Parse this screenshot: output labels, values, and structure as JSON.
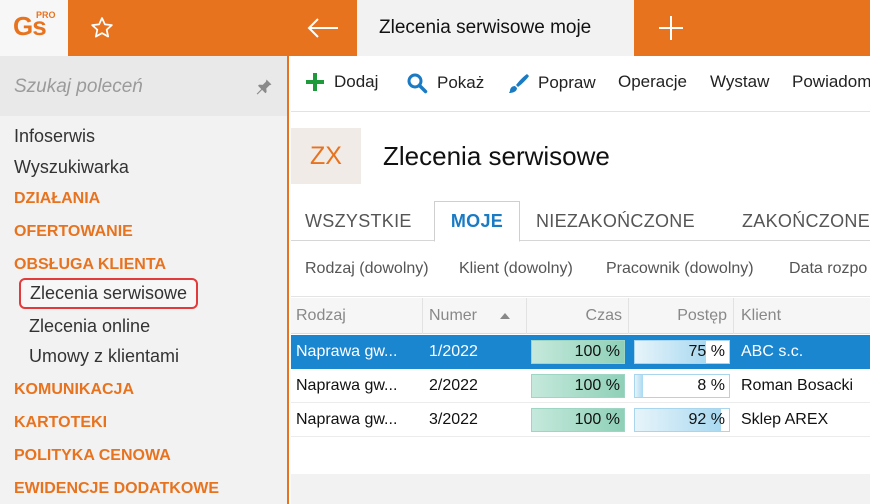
{
  "app": {
    "logo_text": "Gs",
    "logo_badge": "PRO",
    "active_tab_title": "Zlecenia serwisowe moje"
  },
  "colors": {
    "accent": "#e8731f",
    "selection": "#1a86d0",
    "tab_active_text": "#1a7bc4",
    "highlight_border": "#e33b3b"
  },
  "icons": {
    "favorite": "star-icon",
    "back": "arrow-left-icon",
    "new_tab": "plus-icon",
    "pin": "pin-icon",
    "add": "plus-icon",
    "show": "search-icon",
    "edit": "brush-icon"
  },
  "sidebar": {
    "search_placeholder": "Szukaj poleceń",
    "items": [
      {
        "label": "Infoserwis",
        "kind": "item"
      },
      {
        "label": "Wyszukiwarka",
        "kind": "item"
      },
      {
        "label": "DZIAŁANIA",
        "kind": "section"
      },
      {
        "label": "OFERTOWANIE",
        "kind": "section"
      },
      {
        "label": "OBSŁUGA KLIENTA",
        "kind": "section"
      },
      {
        "label": "Zlecenia serwisowe",
        "kind": "sub",
        "selected": true
      },
      {
        "label": "Zlecenia online",
        "kind": "sub"
      },
      {
        "label": "Umowy z klientami",
        "kind": "sub"
      },
      {
        "label": "KOMUNIKACJA",
        "kind": "section"
      },
      {
        "label": "KARTOTEKI",
        "kind": "section"
      },
      {
        "label": "POLITYKA CENOWA",
        "kind": "section"
      },
      {
        "label": "EWIDENCJE DODATKOWE",
        "kind": "section"
      }
    ]
  },
  "toolbar": {
    "add_label": "Dodaj",
    "show_label": "Pokaż",
    "edit_label": "Popraw",
    "operations_label": "Operacje",
    "issue_label": "Wystaw",
    "related_label": "Powiadom"
  },
  "header": {
    "badge": "ZX",
    "title": "Zlecenia serwisowe"
  },
  "tabs": [
    {
      "label": "WSZYSTKIE",
      "active": false
    },
    {
      "label": "MOJE",
      "active": true
    },
    {
      "label": "NIEZAKOŃCZONE",
      "active": false
    },
    {
      "label": "ZAKOŃCZONE",
      "active": false
    }
  ],
  "filters": [
    "Rodzaj (dowolny)",
    "Klient (dowolny)",
    "Pracownik (dowolny)",
    "Data rozpo"
  ],
  "table": {
    "columns": [
      "Rodzaj",
      "Numer",
      "Czas",
      "Postęp",
      "Klient"
    ],
    "sorted_column": "Numer",
    "sort_direction": "ascending",
    "rows": [
      {
        "rodzaj": "Naprawa gw...",
        "numer": "1/2022",
        "czas": "100 %",
        "czas_value": 100,
        "postep": "75 %",
        "postep_value": 75,
        "klient": "ABC s.c.",
        "selected": true
      },
      {
        "rodzaj": "Naprawa gw...",
        "numer": "2/2022",
        "czas": "100 %",
        "czas_value": 100,
        "postep": "8 %",
        "postep_value": 8,
        "klient": "Roman Bosacki",
        "selected": false
      },
      {
        "rodzaj": "Naprawa gw...",
        "numer": "3/2022",
        "czas": "100 %",
        "czas_value": 100,
        "postep": "92 %",
        "postep_value": 92,
        "klient": "Sklep AREX",
        "selected": false
      }
    ]
  }
}
